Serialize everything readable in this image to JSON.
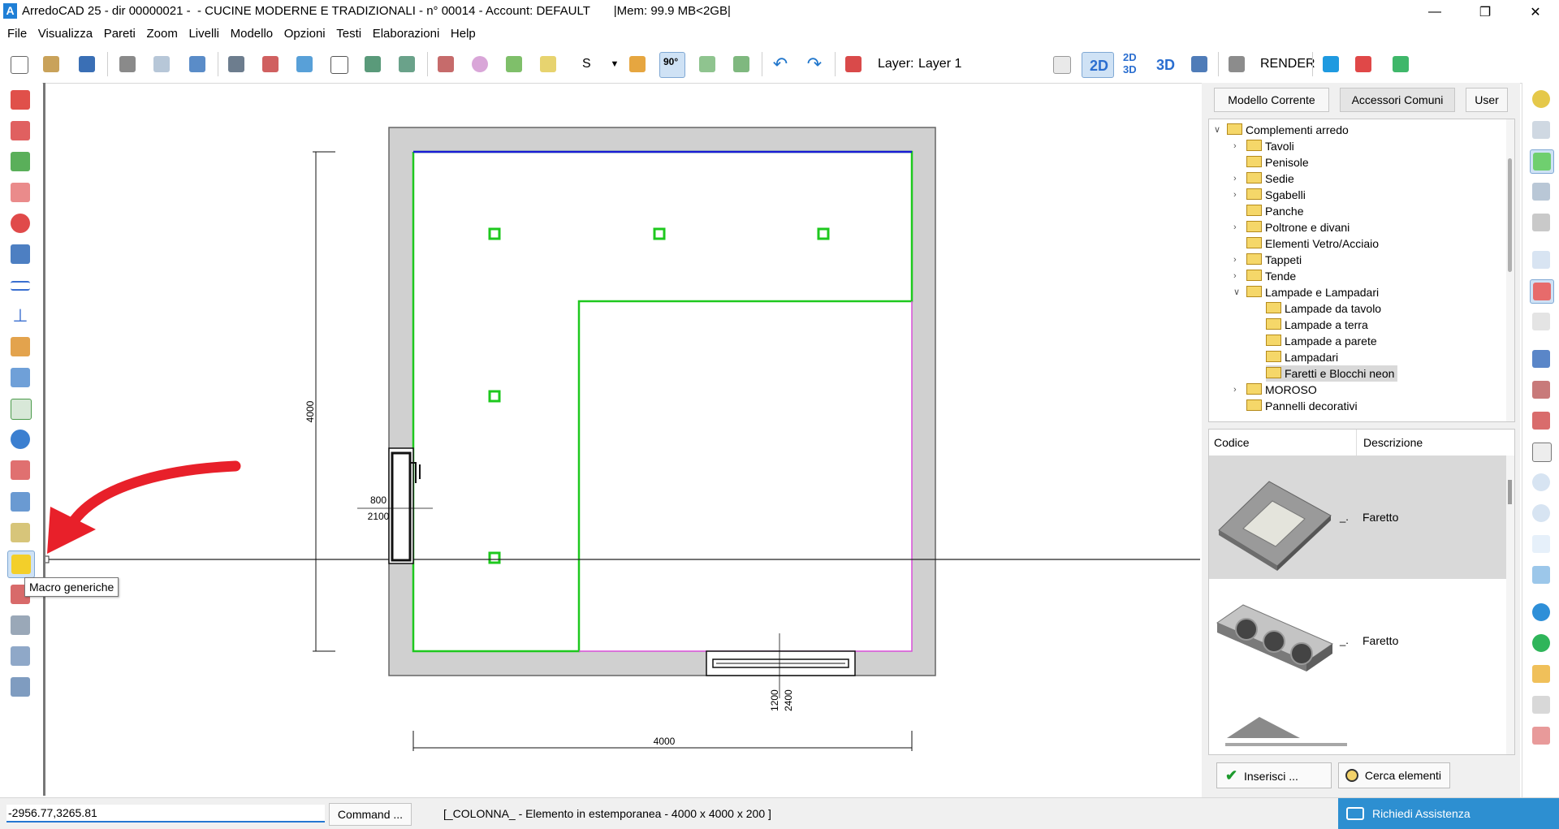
{
  "window": {
    "title": "ArredoCAD 25 - dir 00000021 -  - CUCINE MODERNE E TRADIZIONALI - n° 00014 - Account: DEFAULT       |Mem: 99.9 MB<2GB|",
    "app_icon_letter": "A",
    "minimize": "—",
    "maximize": "❐",
    "close": "✕"
  },
  "menu": [
    "File",
    "Visualizza",
    "Pareti",
    "Zoom",
    "Livelli",
    "Modello",
    "Opzioni",
    "Testi",
    "Elaborazioni",
    "Help"
  ],
  "toolbar": {
    "s_label": "S",
    "angle_label": "90°",
    "layer_label": "Layer:",
    "layer_value": "Layer 1",
    "view_2d": "2D",
    "view_2d3d_top": "2D",
    "view_2d3d_bottom": "3D",
    "view_3d": "3D",
    "render": "RENDER"
  },
  "drawing": {
    "dim_left": "4000",
    "dim_bottom": "4000",
    "door_top": "800",
    "door_bottom": "2100",
    "window_a": "1200",
    "window_b": "2400",
    "colors": {
      "wall": "#d0d0d0",
      "room": "#1ec81e",
      "top_edge": "#1a1ad6",
      "magenta": "#d84fd8",
      "arrow": "#e8202a"
    }
  },
  "tooltip": "Macro generiche",
  "panel": {
    "tabs": [
      "Modello Corrente",
      "Accessori Comuni",
      "User"
    ],
    "tree": {
      "root": "Complementi arredo",
      "items": [
        "Tavoli",
        "Penisole",
        "Sedie",
        "Sgabelli",
        "Panche",
        "Poltrone e divani",
        "Elementi Vetro/Acciaio",
        "Tappeti",
        "Tende",
        "Lampade e Lampadari"
      ],
      "subitems": [
        "Lampade da tavolo",
        "Lampade a terra",
        "Lampade a parete",
        "Lampadari",
        "Faretti e Blocchi neon"
      ],
      "after": [
        "MOROSO",
        "Pannelli decorativi"
      ]
    },
    "grid": {
      "col_code": "Codice",
      "col_desc": "Descrizione",
      "rows": [
        {
          "code": "_.",
          "desc": "Faretto"
        },
        {
          "code": "_.",
          "desc": "Faretto"
        }
      ]
    },
    "insert_button": "Inserisci ...",
    "search_button": "Cerca elementi"
  },
  "status": {
    "coords": "-2956.77,3265.81",
    "command_button": "Command ...",
    "message": "[_COLONNA_ - Elemento in estemporanea - 4000 x 4000 x 200 ]",
    "assist": "Richiedi Assistenza"
  }
}
